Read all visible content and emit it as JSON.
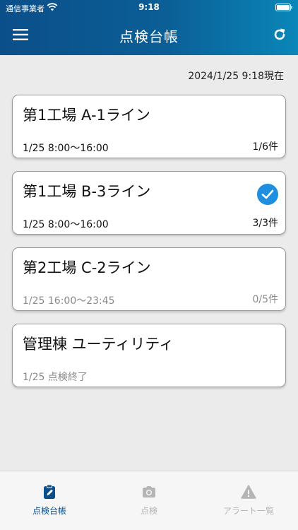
{
  "status_bar": {
    "carrier": "通信事業者",
    "time": "9:18"
  },
  "header": {
    "title": "点検台帳"
  },
  "timestamp": "2024/1/25  9:18現在",
  "cards": [
    {
      "title": "第1工場 A-1ライン",
      "schedule": "1/25  8:00〜16:00",
      "count": "1/6件",
      "completed": false
    },
    {
      "title": "第1工場 B-3ライン",
      "schedule": "1/25  8:00〜16:00",
      "count": "3/3件",
      "completed": true
    },
    {
      "title": "第2工場 C-2ライン",
      "schedule": "1/25  16:00〜23:45",
      "count": "0/5件",
      "completed": false
    },
    {
      "title": "管理棟 ユーティリティ",
      "schedule": "1/25  点検終了",
      "count": "",
      "completed": false
    }
  ],
  "tabs": [
    {
      "label": "点検台帳",
      "icon": "clipboard-edit-icon",
      "active": true
    },
    {
      "label": "点検",
      "icon": "camera-icon",
      "active": false
    },
    {
      "label": "アラート一覧",
      "icon": "warning-icon",
      "active": false
    }
  ],
  "colors": {
    "header_start": "#0b4f8a",
    "header_end": "#0a86b8",
    "accent": "#1e8fe0",
    "active_tab": "#0b4f8a"
  }
}
